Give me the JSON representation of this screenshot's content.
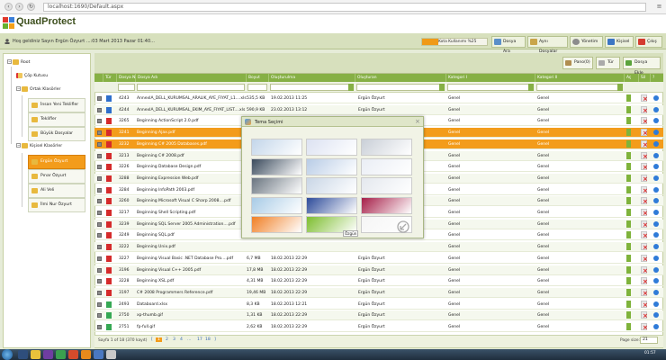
{
  "browser": {
    "url": "localhost:1690/Default.aspx",
    "menu_glyph": "≡"
  },
  "app": {
    "name": "QuadProtect",
    "welcome": "Hoş geldiniz Sayın Ergün Özyurt   ...:03 Mart 2013 Pazar 01:40..."
  },
  "quota": {
    "label": "Kota Kullanımı %25",
    "percent": 25
  },
  "top_buttons": [
    {
      "label": "Dosya Ara",
      "icon": "search-icon"
    },
    {
      "label": "Aynı Dosyalar",
      "icon": "duplicate-icon"
    },
    {
      "label": "Yönetim",
      "icon": "gear-icon"
    },
    {
      "label": "Kişisel",
      "icon": "user-icon"
    },
    {
      "label": "Çıkış",
      "icon": "exit-icon"
    }
  ],
  "tree": [
    {
      "label": "Root",
      "level": 0
    },
    {
      "label": "Çöp Kutusu",
      "level": 1
    },
    {
      "label": "Ortak Klasörler",
      "level": 1
    },
    {
      "label": "İnsan Yeni Teklifler",
      "level": 2
    },
    {
      "label": "Teklifler",
      "level": 2
    },
    {
      "label": "Büyük Dosyalar",
      "level": 2
    },
    {
      "label": "Kişisel Klasörler",
      "level": 1
    },
    {
      "label": "Ergün Özyurt",
      "level": 2,
      "selected": true
    },
    {
      "label": "Pınar Özyurt",
      "level": 2
    },
    {
      "label": "Ali Veli",
      "level": 2
    },
    {
      "label": "İlmi Nur Özyurt",
      "level": 2
    }
  ],
  "toolbar": {
    "paste": "Pano(0)",
    "type": "Tür",
    "add_file": "Dosya Ekle"
  },
  "columns": [
    "Tür",
    "Dosya No",
    "Dosya Adı",
    "Boyut",
    "Oluşturulma",
    "Oluşturan",
    "Kategori I",
    "Kategori II",
    "Aç",
    "Sil",
    "?"
  ],
  "rows": [
    {
      "no": "4243",
      "name": "AnnexIA_DELL_KURUMSAL_ARALIK_AYE_FIYAT_L1....xls",
      "size": "535,5 KB",
      "date": "19.02.2013 11:25",
      "owner": "Ergün Özyurt",
      "cat1": "Genel",
      "cat2": "Genel",
      "type": "b"
    },
    {
      "no": "4244",
      "name": "AnnexIA_DELL_KURUMSAL_EKIM_AYE_FIYAT_LIST....xls",
      "size": "590,9 KB",
      "date": "23.02.2013 13:12",
      "owner": "Ergün Özyurt",
      "cat1": "Genel",
      "cat2": "Genel",
      "type": "b"
    },
    {
      "no": "3265",
      "name": "Beginning ActionScript 2.0.pdf",
      "size": "",
      "date": "",
      "owner": "",
      "cat1": "Genel",
      "cat2": "Genel",
      "type": "r"
    },
    {
      "no": "3241",
      "name": "Beginning Ajax.pdf",
      "size": "",
      "date": "",
      "owner": "",
      "cat1": "Genel",
      "cat2": "Genel",
      "type": "r",
      "hl": true
    },
    {
      "no": "3232",
      "name": "Beginning C# 2005 Databases.pdf",
      "size": "",
      "date": "",
      "owner": "",
      "cat1": "Genel",
      "cat2": "Genel",
      "type": "r",
      "hl": true
    },
    {
      "no": "3213",
      "name": "Beginning C# 2008.pdf",
      "size": "",
      "date": "",
      "owner": "",
      "cat1": "Genel",
      "cat2": "Genel",
      "type": "r"
    },
    {
      "no": "3226",
      "name": "Beginning Database Design.pdf",
      "size": "",
      "date": "",
      "owner": "",
      "cat1": "Genel",
      "cat2": "Genel",
      "type": "r"
    },
    {
      "no": "3288",
      "name": "Beginning Expression Web.pdf",
      "size": "",
      "date": "",
      "owner": "",
      "cat1": "Genel",
      "cat2": "Genel",
      "type": "r"
    },
    {
      "no": "3284",
      "name": "Beginning InfoPath 2003.pdf",
      "size": "",
      "date": "",
      "owner": "",
      "cat1": "Genel",
      "cat2": "Genel",
      "type": "r"
    },
    {
      "no": "3260",
      "name": "Beginning Microsoft Visual C Sharp 2008....pdf",
      "size": "",
      "date": "",
      "owner": "",
      "cat1": "Genel",
      "cat2": "Genel",
      "type": "r"
    },
    {
      "no": "3217",
      "name": "Beginning Shell Scripting.pdf",
      "size": "",
      "date": "",
      "owner": "",
      "cat1": "Genel",
      "cat2": "Genel",
      "type": "r"
    },
    {
      "no": "3239",
      "name": "Beginning SQL Server 2005 Administration....pdf",
      "size": "",
      "date": "",
      "owner": "",
      "cat1": "Genel",
      "cat2": "Genel",
      "type": "r"
    },
    {
      "no": "3249",
      "name": "Beginning SQL.pdf",
      "size": "",
      "date": "",
      "owner": "",
      "cat1": "Genel",
      "cat2": "Genel",
      "type": "r"
    },
    {
      "no": "3222",
      "name": "Beginning Unix.pdf",
      "size": "",
      "date": "",
      "owner": "",
      "cat1": "Genel",
      "cat2": "Genel",
      "type": "r"
    },
    {
      "no": "3227",
      "name": "Beginning Visual Basic .NET Database Pro....pdf",
      "size": "6,7 MB",
      "date": "18.02.2013 22:29",
      "owner": "Ergün Özyurt",
      "cat1": "Genel",
      "cat2": "Genel",
      "type": "r"
    },
    {
      "no": "3196",
      "name": "Beginning Visual C++ 2005.pdf",
      "size": "17,8 MB",
      "date": "18.02.2013 22:29",
      "owner": "Ergün Özyurt",
      "cat1": "Genel",
      "cat2": "Genel",
      "type": "r"
    },
    {
      "no": "3228",
      "name": "Beginning XSL.pdf",
      "size": "4,31 MB",
      "date": "18.02.2013 22:29",
      "owner": "Ergün Özyurt",
      "cat1": "Genel",
      "cat2": "Genel",
      "type": "r"
    },
    {
      "no": "3197",
      "name": "C# 2008 Programmers Reference.pdf",
      "size": "19,46 MB",
      "date": "18.02.2013 22:29",
      "owner": "Ergün Özyurt",
      "cat1": "Genel",
      "cat2": "Genel",
      "type": "r"
    },
    {
      "no": "2493",
      "name": "Databoard.xlsx",
      "size": "8,3 KB",
      "date": "18.02.2013 12:21",
      "owner": "Ergün Özyurt",
      "cat1": "Genel",
      "cat2": "Genel",
      "type": "g"
    },
    {
      "no": "2750",
      "name": "xp-thumb.gif",
      "size": "1,31 KB",
      "date": "18.02.2013 22:29",
      "owner": "Ergün Özyurt",
      "cat1": "Genel",
      "cat2": "Genel",
      "type": "g"
    },
    {
      "no": "2751",
      "name": "fp-full.gif",
      "size": "2,62 KB",
      "date": "18.02.2013 22:29",
      "owner": "Ergün Özyurt",
      "cat1": "Genel",
      "cat2": "Genel",
      "type": "g"
    }
  ],
  "pager": {
    "info": "Sayfa 1 of 18 (370 kayıt)",
    "pages": [
      "1",
      "2",
      "3",
      "4",
      "...",
      "17",
      "18"
    ],
    "current": "1",
    "prev": "[",
    "next": "]",
    "size_label": "Page size:",
    "size": "21"
  },
  "dialog": {
    "title": "Tema Seçimi",
    "close": "×",
    "tooltip": "Özgün",
    "themes": [
      "#c3d6ea",
      "#dce2f2",
      "#c9cfd7",
      "#3a4a5c",
      "#b8cce6",
      "#eaeef5",
      "#6a7580",
      "#c9d6e6",
      "#e4e8ee",
      "#a8cbe6",
      "#2d4b9a",
      "#a61e48",
      "#f07f24",
      "#7dbd2e",
      "#f5f5f5"
    ]
  },
  "taskbar": {
    "clock": "01:57"
  }
}
